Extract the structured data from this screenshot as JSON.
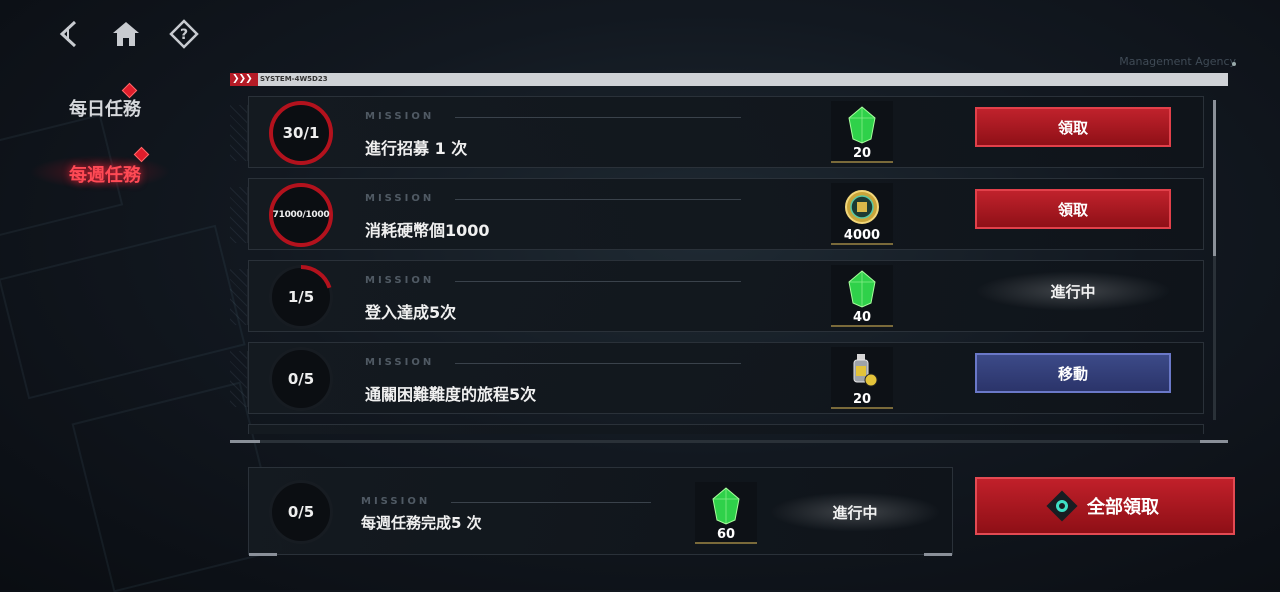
{
  "nav": {
    "back_icon": "back-icon",
    "home_icon": "home-icon",
    "help_icon": "help-icon"
  },
  "tabs": [
    {
      "label": "每日任務",
      "active": false,
      "alert": true
    },
    {
      "label": "每週任務",
      "active": true,
      "alert": true
    }
  ],
  "agency_label": "Management Agency",
  "header": {
    "system_code": "SYSTEM-4W5D23"
  },
  "missions": [
    {
      "progress": "30/1",
      "progress_ratio": 1.0,
      "tag": "MISSION",
      "title": "進行招募 1 次",
      "reward_icon": "green-crystal-icon",
      "reward_qty": "20",
      "action": "領取",
      "action_type": "claim"
    },
    {
      "progress": "71000/1000",
      "progress_ratio": 1.0,
      "tag": "MISSION",
      "title": "消耗硬幣個1000",
      "reward_icon": "coin-icon",
      "reward_qty": "4000",
      "action": "領取",
      "action_type": "claim"
    },
    {
      "progress": "1/5",
      "progress_ratio": 0.2,
      "tag": "MISSION",
      "title": "登入達成5次",
      "reward_icon": "green-crystal-icon",
      "reward_qty": "40",
      "action": "進行中",
      "action_type": "in-progress"
    },
    {
      "progress": "0/5",
      "progress_ratio": 0.0,
      "tag": "MISSION",
      "title": "通關困難難度的旅程5次",
      "reward_icon": "potion-icon",
      "reward_qty": "20",
      "action": "移動",
      "action_type": "move"
    }
  ],
  "summary": {
    "progress": "0/5",
    "tag": "MISSION",
    "title": "每週任務完成5 次",
    "reward_icon": "green-crystal-icon",
    "reward_qty": "60",
    "status": "進行中"
  },
  "claim_all": {
    "label": "全部領取"
  },
  "colors": {
    "accent_red": "#b3121d",
    "move_blue": "#3c4a88",
    "gem_green": "#2fd14a"
  }
}
